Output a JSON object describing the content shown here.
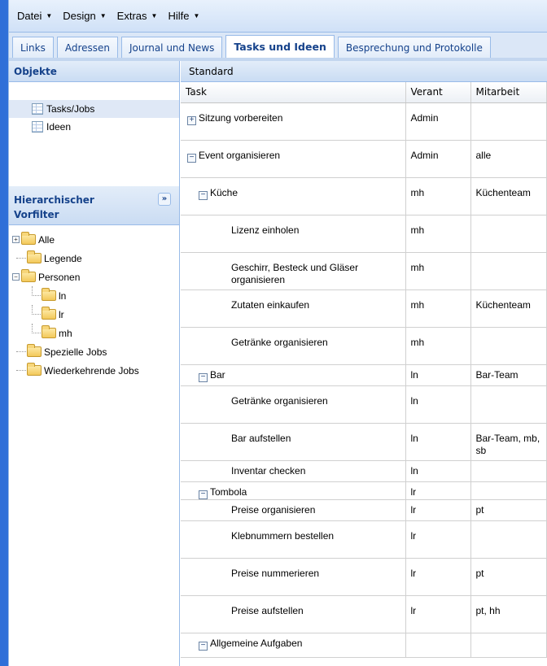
{
  "menu": [
    {
      "label": "Datei"
    },
    {
      "label": "Design"
    },
    {
      "label": "Extras"
    },
    {
      "label": "Hilfe"
    }
  ],
  "tabs": [
    {
      "label": "Links",
      "active": false
    },
    {
      "label": "Adressen",
      "active": false
    },
    {
      "label": "Journal und News",
      "active": false
    },
    {
      "label": "Tasks und Ideen",
      "active": true
    },
    {
      "label": "Besprechung und Protokolle",
      "active": false
    }
  ],
  "objekte": {
    "title": "Objekte",
    "items": [
      {
        "label": "Tasks/Jobs",
        "selected": true
      },
      {
        "label": "Ideen",
        "selected": false
      }
    ]
  },
  "vorfilter": {
    "title_line1": "Hierarchischer",
    "title_line2": "Vorfilter",
    "tree": [
      {
        "label": "Alle",
        "level": 0,
        "expander": "+"
      },
      {
        "label": "Legende",
        "level": 1,
        "expander": ""
      },
      {
        "label": "Personen",
        "level": 0,
        "expander": "-"
      },
      {
        "label": "ln",
        "level": 2,
        "expander": ""
      },
      {
        "label": "lr",
        "level": 2,
        "expander": ""
      },
      {
        "label": "mh",
        "level": 2,
        "expander": ""
      },
      {
        "label": "Spezielle Jobs",
        "level": 1,
        "expander": ""
      },
      {
        "label": "Wiederkehrende Jobs",
        "level": 1,
        "expander": ""
      }
    ]
  },
  "grid": {
    "view": "Standard",
    "columns": [
      "Task",
      "Verant",
      "Mitarbeit"
    ],
    "rows": [
      {
        "task": "Sitzung vorbereiten",
        "indent": 0,
        "toggle": "+",
        "verant": "Admin",
        "mitarbeit": "",
        "h": 46
      },
      {
        "task": "Event organisieren",
        "indent": 0,
        "toggle": "-",
        "verant": "Admin",
        "mitarbeit": "alle",
        "h": 46
      },
      {
        "task": "Küche",
        "indent": 1,
        "toggle": "-",
        "verant": "mh",
        "mitarbeit": "Küchenteam",
        "h": 46
      },
      {
        "task": "Lizenz einholen",
        "indent": 2,
        "toggle": "",
        "verant": "mh",
        "mitarbeit": "",
        "h": 46
      },
      {
        "task": "Geschirr, Besteck und Gläser organisieren",
        "indent": 2,
        "toggle": "",
        "verant": "mh",
        "mitarbeit": "",
        "h": 46
      },
      {
        "task": "Zutaten einkaufen",
        "indent": 2,
        "toggle": "",
        "verant": "mh",
        "mitarbeit": "Küchenteam",
        "h": 46
      },
      {
        "task": "Getränke organisieren",
        "indent": 2,
        "toggle": "",
        "verant": "mh",
        "mitarbeit": "",
        "h": 46
      },
      {
        "task": "Bar",
        "indent": 1,
        "toggle": "-",
        "verant": "ln",
        "mitarbeit": "Bar-Team",
        "h": 26
      },
      {
        "task": "Getränke organisieren",
        "indent": 2,
        "toggle": "",
        "verant": "ln",
        "mitarbeit": "",
        "h": 46
      },
      {
        "task": "Bar aufstellen",
        "indent": 2,
        "toggle": "",
        "verant": "ln",
        "mitarbeit": "Bar-Team, mb, sb",
        "h": 46
      },
      {
        "task": "Inventar checken",
        "indent": 2,
        "toggle": "",
        "verant": "ln",
        "mitarbeit": "",
        "h": 26
      },
      {
        "task": "Tombola",
        "indent": 1,
        "toggle": "-",
        "verant": "lr",
        "mitarbeit": "",
        "h": 20
      },
      {
        "task": "Preise organisieren",
        "indent": 2,
        "toggle": "",
        "verant": "lr",
        "mitarbeit": "pt",
        "h": 26
      },
      {
        "task": "Klebnummern bestellen",
        "indent": 2,
        "toggle": "",
        "verant": "lr",
        "mitarbeit": "",
        "h": 46
      },
      {
        "task": "Preise nummerieren",
        "indent": 2,
        "toggle": "",
        "verant": "lr",
        "mitarbeit": "pt",
        "h": 46
      },
      {
        "task": "Preise aufstellen",
        "indent": 2,
        "toggle": "",
        "verant": "lr",
        "mitarbeit": "pt, hh",
        "h": 46
      },
      {
        "task": "Allgemeine Aufgaben",
        "indent": 1,
        "toggle": "-",
        "verant": "",
        "mitarbeit": "",
        "h": 30
      }
    ]
  }
}
